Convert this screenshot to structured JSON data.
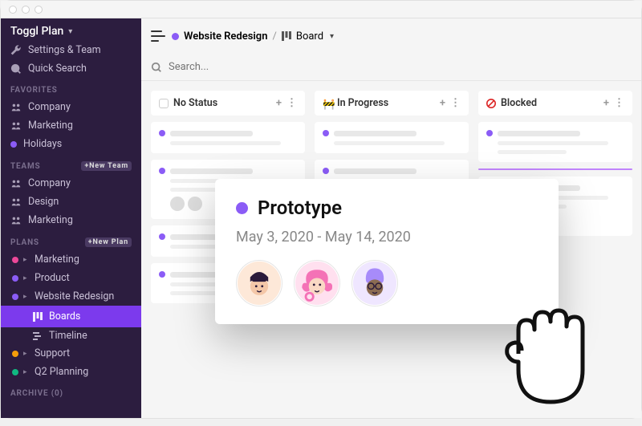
{
  "app_name": "Toggl Plan",
  "settings": {
    "label": "Settings & Team"
  },
  "quick_search": {
    "label": "Quick Search"
  },
  "favorites": {
    "header": "FAVORITES",
    "items": [
      {
        "label": "Company",
        "icon": "people-icon"
      },
      {
        "label": "Marketing",
        "icon": "people-icon"
      },
      {
        "label": "Holidays",
        "color": "#8b5cf6"
      }
    ]
  },
  "teams": {
    "header": "TEAMS",
    "add_label": "+New Team",
    "items": [
      {
        "label": "Company"
      },
      {
        "label": "Design"
      },
      {
        "label": "Marketing"
      }
    ]
  },
  "plans": {
    "header": "PLANS",
    "add_label": "+New Plan",
    "items": [
      {
        "label": "Marketing",
        "color": "#ec4899",
        "expanded": false
      },
      {
        "label": "Product",
        "color": "#8b5cf6",
        "expanded": false
      },
      {
        "label": "Website Redesign",
        "color": "#8b5cf6",
        "expanded": true,
        "children": [
          {
            "label": "Boards",
            "active": true
          },
          {
            "label": "Timeline",
            "active": false
          }
        ]
      },
      {
        "label": "Support",
        "color": "#f59e0b",
        "expanded": false
      },
      {
        "label": "Q2 Planning",
        "color": "#10b981",
        "expanded": false
      }
    ]
  },
  "archive": {
    "header": "ARCHIVE (0)"
  },
  "breadcrumb": {
    "project": "Website Redesign",
    "view": "Board",
    "separator": "/"
  },
  "search": {
    "placeholder": "Search..."
  },
  "board": {
    "columns": [
      {
        "title": "No Status",
        "status_icon": "empty-status-icon"
      },
      {
        "title": "In Progress",
        "status_icon": "construction-icon"
      },
      {
        "title": "Blocked",
        "status_icon": "no-entry-icon"
      }
    ]
  },
  "popup": {
    "title": "Prototype",
    "date_range": "May 3, 2020 - May 14, 2020",
    "assignees": [
      "avatar-1",
      "avatar-2",
      "avatar-3"
    ]
  }
}
